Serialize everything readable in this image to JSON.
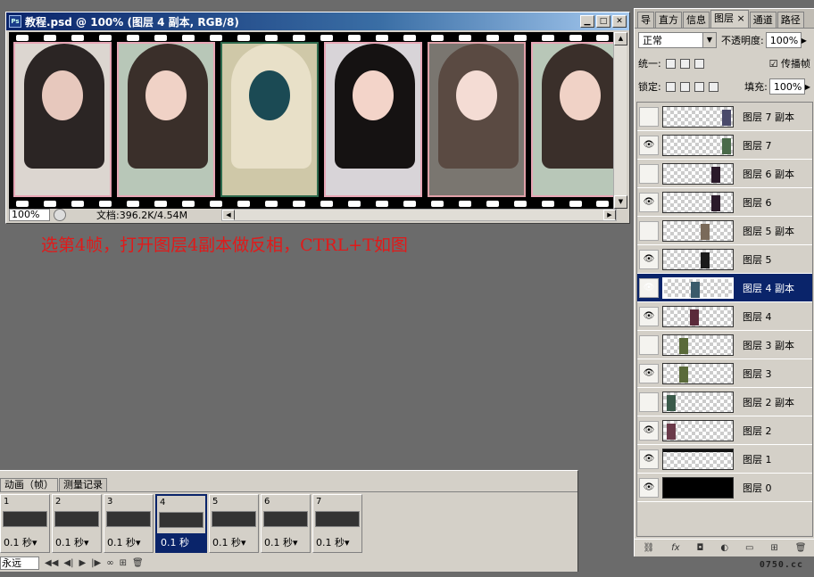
{
  "document": {
    "title": "教程.psd @ 100% (图层 4 副本, RGB/8)",
    "zoom": "100%",
    "doc_info": "文档:396.2K/4.54M"
  },
  "caption": "选第4帧，打开图层4副本做反相，CTRL+T如图",
  "layers_panel": {
    "tabs": [
      "导",
      "直方",
      "信息",
      "图层",
      "通道",
      "路径"
    ],
    "active_tab": "图层",
    "blend_mode": "正常",
    "opacity_label": "不透明度:",
    "opacity": "100%",
    "unify_label": "统一:",
    "propagate_label": "传播帧",
    "lock_label": "锁定:",
    "fill_label": "填充:",
    "fill": "100%",
    "layers": [
      {
        "name": "图层 7 副本",
        "visible": false
      },
      {
        "name": "图层 7",
        "visible": true
      },
      {
        "name": "图层 6 副本",
        "visible": false
      },
      {
        "name": "图层 6",
        "visible": true
      },
      {
        "name": "图层 5 副本",
        "visible": false
      },
      {
        "name": "图层 5",
        "visible": true
      },
      {
        "name": "图层 4 副本",
        "visible": true,
        "selected": true
      },
      {
        "name": "图层 4",
        "visible": true
      },
      {
        "name": "图层 3 副本",
        "visible": false
      },
      {
        "name": "图层 3",
        "visible": true
      },
      {
        "name": "图层 2 副本",
        "visible": false
      },
      {
        "name": "图层 2",
        "visible": true
      },
      {
        "name": "图层 1",
        "visible": true
      },
      {
        "name": "图层 0",
        "visible": true
      }
    ]
  },
  "animation_panel": {
    "tabs": [
      "动画（帧）",
      "测量记录"
    ],
    "frames": [
      {
        "num": "1",
        "delay": "0.1 秒"
      },
      {
        "num": "2",
        "delay": "0.1 秒"
      },
      {
        "num": "3",
        "delay": "0.1 秒"
      },
      {
        "num": "4",
        "delay": "0.1 秒",
        "selected": true
      },
      {
        "num": "5",
        "delay": "0.1 秒"
      },
      {
        "num": "6",
        "delay": "0.1 秒"
      },
      {
        "num": "7",
        "delay": "0.1 秒"
      }
    ],
    "loop": "永远"
  },
  "watermark": "0750.cc",
  "colors": {
    "accent": "#0a246a",
    "caption": "#e01a1a",
    "frame_border": "#e8a6b6"
  }
}
